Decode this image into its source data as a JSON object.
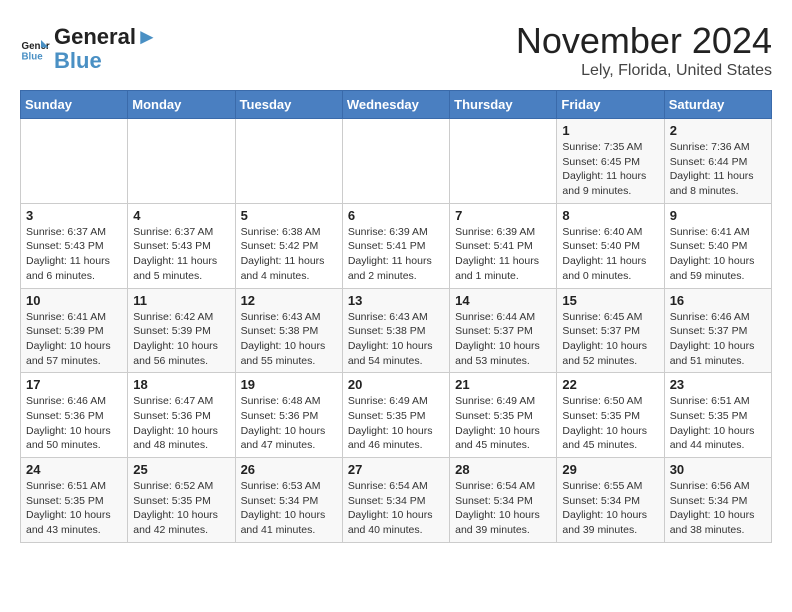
{
  "logo": {
    "line1": "General",
    "line2": "Blue"
  },
  "title": "November 2024",
  "location": "Lely, Florida, United States",
  "days_of_week": [
    "Sunday",
    "Monday",
    "Tuesday",
    "Wednesday",
    "Thursday",
    "Friday",
    "Saturday"
  ],
  "weeks": [
    [
      {
        "day": "",
        "info": ""
      },
      {
        "day": "",
        "info": ""
      },
      {
        "day": "",
        "info": ""
      },
      {
        "day": "",
        "info": ""
      },
      {
        "day": "",
        "info": ""
      },
      {
        "day": "1",
        "info": "Sunrise: 7:35 AM\nSunset: 6:45 PM\nDaylight: 11 hours and 9 minutes."
      },
      {
        "day": "2",
        "info": "Sunrise: 7:36 AM\nSunset: 6:44 PM\nDaylight: 11 hours and 8 minutes."
      }
    ],
    [
      {
        "day": "3",
        "info": "Sunrise: 6:37 AM\nSunset: 5:43 PM\nDaylight: 11 hours and 6 minutes."
      },
      {
        "day": "4",
        "info": "Sunrise: 6:37 AM\nSunset: 5:43 PM\nDaylight: 11 hours and 5 minutes."
      },
      {
        "day": "5",
        "info": "Sunrise: 6:38 AM\nSunset: 5:42 PM\nDaylight: 11 hours and 4 minutes."
      },
      {
        "day": "6",
        "info": "Sunrise: 6:39 AM\nSunset: 5:41 PM\nDaylight: 11 hours and 2 minutes."
      },
      {
        "day": "7",
        "info": "Sunrise: 6:39 AM\nSunset: 5:41 PM\nDaylight: 11 hours and 1 minute."
      },
      {
        "day": "8",
        "info": "Sunrise: 6:40 AM\nSunset: 5:40 PM\nDaylight: 11 hours and 0 minutes."
      },
      {
        "day": "9",
        "info": "Sunrise: 6:41 AM\nSunset: 5:40 PM\nDaylight: 10 hours and 59 minutes."
      }
    ],
    [
      {
        "day": "10",
        "info": "Sunrise: 6:41 AM\nSunset: 5:39 PM\nDaylight: 10 hours and 57 minutes."
      },
      {
        "day": "11",
        "info": "Sunrise: 6:42 AM\nSunset: 5:39 PM\nDaylight: 10 hours and 56 minutes."
      },
      {
        "day": "12",
        "info": "Sunrise: 6:43 AM\nSunset: 5:38 PM\nDaylight: 10 hours and 55 minutes."
      },
      {
        "day": "13",
        "info": "Sunrise: 6:43 AM\nSunset: 5:38 PM\nDaylight: 10 hours and 54 minutes."
      },
      {
        "day": "14",
        "info": "Sunrise: 6:44 AM\nSunset: 5:37 PM\nDaylight: 10 hours and 53 minutes."
      },
      {
        "day": "15",
        "info": "Sunrise: 6:45 AM\nSunset: 5:37 PM\nDaylight: 10 hours and 52 minutes."
      },
      {
        "day": "16",
        "info": "Sunrise: 6:46 AM\nSunset: 5:37 PM\nDaylight: 10 hours and 51 minutes."
      }
    ],
    [
      {
        "day": "17",
        "info": "Sunrise: 6:46 AM\nSunset: 5:36 PM\nDaylight: 10 hours and 50 minutes."
      },
      {
        "day": "18",
        "info": "Sunrise: 6:47 AM\nSunset: 5:36 PM\nDaylight: 10 hours and 48 minutes."
      },
      {
        "day": "19",
        "info": "Sunrise: 6:48 AM\nSunset: 5:36 PM\nDaylight: 10 hours and 47 minutes."
      },
      {
        "day": "20",
        "info": "Sunrise: 6:49 AM\nSunset: 5:35 PM\nDaylight: 10 hours and 46 minutes."
      },
      {
        "day": "21",
        "info": "Sunrise: 6:49 AM\nSunset: 5:35 PM\nDaylight: 10 hours and 45 minutes."
      },
      {
        "day": "22",
        "info": "Sunrise: 6:50 AM\nSunset: 5:35 PM\nDaylight: 10 hours and 45 minutes."
      },
      {
        "day": "23",
        "info": "Sunrise: 6:51 AM\nSunset: 5:35 PM\nDaylight: 10 hours and 44 minutes."
      }
    ],
    [
      {
        "day": "24",
        "info": "Sunrise: 6:51 AM\nSunset: 5:35 PM\nDaylight: 10 hours and 43 minutes."
      },
      {
        "day": "25",
        "info": "Sunrise: 6:52 AM\nSunset: 5:35 PM\nDaylight: 10 hours and 42 minutes."
      },
      {
        "day": "26",
        "info": "Sunrise: 6:53 AM\nSunset: 5:34 PM\nDaylight: 10 hours and 41 minutes."
      },
      {
        "day": "27",
        "info": "Sunrise: 6:54 AM\nSunset: 5:34 PM\nDaylight: 10 hours and 40 minutes."
      },
      {
        "day": "28",
        "info": "Sunrise: 6:54 AM\nSunset: 5:34 PM\nDaylight: 10 hours and 39 minutes."
      },
      {
        "day": "29",
        "info": "Sunrise: 6:55 AM\nSunset: 5:34 PM\nDaylight: 10 hours and 39 minutes."
      },
      {
        "day": "30",
        "info": "Sunrise: 6:56 AM\nSunset: 5:34 PM\nDaylight: 10 hours and 38 minutes."
      }
    ]
  ]
}
